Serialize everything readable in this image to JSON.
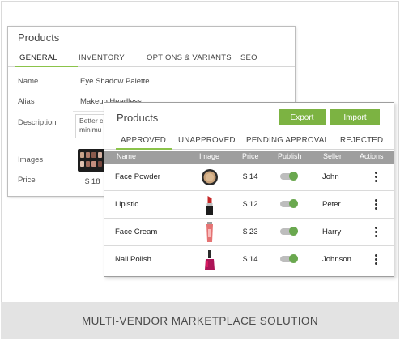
{
  "inventory_panel": {
    "title": "Products",
    "tabs": [
      "GENERAL",
      "INVENTORY",
      "OPTIONS & VARIANTS",
      "SEO"
    ],
    "active_tab": "GENERAL",
    "fields": {
      "name_label": "Name",
      "name_value": "Eye Shadow Palette",
      "alias_label": "Alias",
      "alias_value": "Makeup Headless",
      "description_label": "Description",
      "description_line1": "Better c",
      "description_line2": "minimu",
      "images_label": "Images",
      "price_label": "Price",
      "price_value": "$ 18"
    }
  },
  "products_panel": {
    "title": "Products",
    "export_label": "Export",
    "import_label": "Import",
    "tabs": [
      "APPROVED",
      "UNAPPROVED",
      "PENDING APPROVAL",
      "REJECTED"
    ],
    "active_tab": "APPROVED",
    "columns": [
      "Name",
      "Image",
      "Price",
      "Publish",
      "Seller",
      "Actions"
    ],
    "rows": [
      {
        "name": "Face Powder",
        "image": "face-powder-icon",
        "price": "$ 14",
        "publish": true,
        "seller": "John"
      },
      {
        "name": "Lipistic",
        "image": "lipstick-icon",
        "price": "$ 12",
        "publish": true,
        "seller": "Peter"
      },
      {
        "name": "Face Cream",
        "image": "face-cream-icon",
        "price": "$ 23",
        "publish": true,
        "seller": "Harry"
      },
      {
        "name": "Nail Polish",
        "image": "nail-polish-icon",
        "price": "$ 14",
        "publish": true,
        "seller": "Johnson"
      }
    ]
  },
  "footer": {
    "caption": "MULTI-VENDOR MARKETPLACE SOLUTION"
  },
  "colors": {
    "accent": "#7cb342",
    "table_header": "#9e9e9e",
    "footer_bg": "#e3e3e3"
  }
}
